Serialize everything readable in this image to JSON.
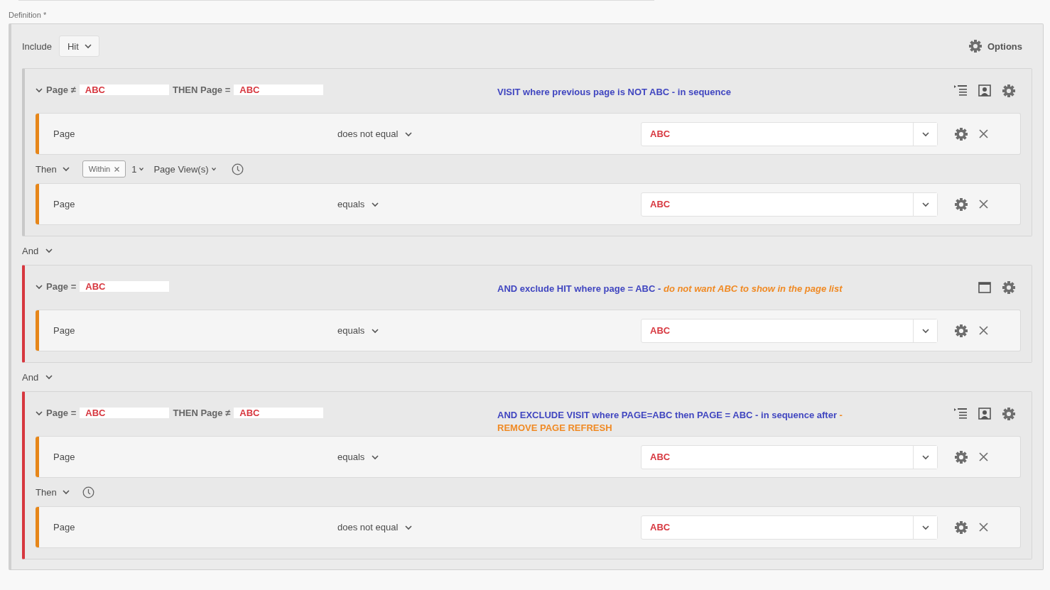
{
  "definition": {
    "label": "Definition",
    "required_mark": "*"
  },
  "include": {
    "label": "Include",
    "value": "Hit"
  },
  "options": {
    "label": "Options"
  },
  "blocks": [
    {
      "kind": "container",
      "expanded": true,
      "exclude": false,
      "header": [
        {
          "kind": "text",
          "text": "Page ≠"
        },
        {
          "kind": "value",
          "text": "ABC"
        },
        {
          "kind": "text",
          "text": "THEN Page ="
        },
        {
          "kind": "value",
          "text": "ABC"
        }
      ],
      "note": [
        {
          "kind": "comment",
          "text": "VISIT where previous page is NOT ABC - in sequence"
        }
      ],
      "icons": [
        {
          "kind": "sequence"
        },
        {
          "kind": "person"
        },
        {
          "kind": "gear"
        }
      ],
      "items": [
        {
          "kind": "rule",
          "dimension": "Page",
          "operator": "does not equal",
          "value": "ABC"
        },
        {
          "kind": "then",
          "label": "Then",
          "within": "Within",
          "count": "1",
          "unit": "Page View(s)"
        },
        {
          "kind": "rule",
          "dimension": "Page",
          "operator": "equals",
          "value": "ABC"
        }
      ]
    },
    {
      "kind": "operator",
      "label": "And"
    },
    {
      "kind": "container",
      "expanded": true,
      "exclude": true,
      "header": [
        {
          "kind": "text",
          "text": "Page ="
        },
        {
          "kind": "value",
          "text": "ABC"
        }
      ],
      "note": [
        {
          "kind": "comment",
          "text": "AND exclude HIT where page = ABC - "
        },
        {
          "kind": "emphasis",
          "text": "do not want ABC to show in the page list"
        }
      ],
      "icons": [
        {
          "kind": "window"
        },
        {
          "kind": "gear"
        }
      ],
      "items": [
        {
          "kind": "rule",
          "dimension": "Page",
          "operator": "equals",
          "value": "ABC"
        }
      ]
    },
    {
      "kind": "operator",
      "label": "And"
    },
    {
      "kind": "container",
      "expanded": true,
      "exclude": true,
      "header": [
        {
          "kind": "text",
          "text": "Page ="
        },
        {
          "kind": "value",
          "text": "ABC"
        },
        {
          "kind": "text",
          "text": "THEN Page ≠"
        },
        {
          "kind": "value",
          "text": "ABC"
        }
      ],
      "note": [
        {
          "kind": "comment",
          "text": "AND EXCLUDE VISIT where PAGE=ABC then PAGE = ABC  - in sequence after "
        },
        {
          "kind": "caution",
          "text": "- REMOVE PAGE REFRESH"
        }
      ],
      "icons": [
        {
          "kind": "sequence"
        },
        {
          "kind": "person"
        },
        {
          "kind": "gear"
        }
      ],
      "items": [
        {
          "kind": "rule",
          "dimension": "Page",
          "operator": "equals",
          "value": "ABC"
        },
        {
          "kind": "then",
          "label": "Then"
        },
        {
          "kind": "rule",
          "dimension": "Page",
          "operator": "does not equal",
          "value": "ABC"
        }
      ]
    }
  ]
}
